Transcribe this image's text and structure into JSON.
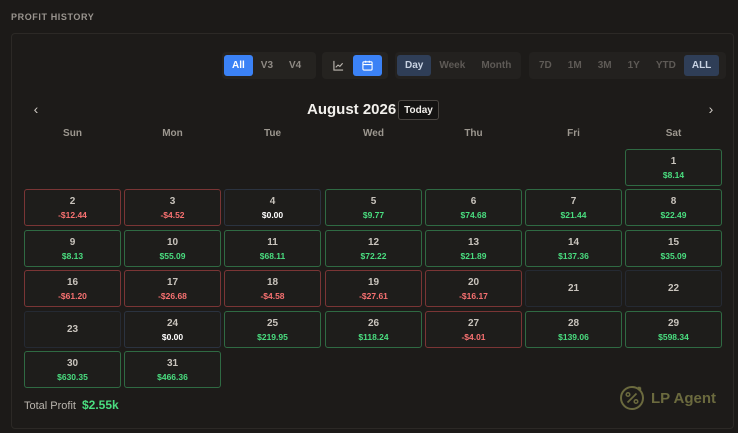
{
  "section_title": "PROFIT HISTORY",
  "version_filter": {
    "options": [
      "All",
      "V3",
      "V4"
    ],
    "selected": "All"
  },
  "view_toggle": {
    "icons": [
      "chart-line-icon",
      "calendar-icon"
    ],
    "selected": "calendar-icon"
  },
  "granularity_filter": {
    "options": [
      "Day",
      "Week",
      "Month"
    ],
    "selected": "Day"
  },
  "range_filter": {
    "options": [
      "7D",
      "1M",
      "3M",
      "1Y",
      "YTD",
      "ALL"
    ],
    "selected": "ALL"
  },
  "calendar": {
    "month_label": "August 2026",
    "today_label": "Today",
    "weekdays": [
      "Sun",
      "Mon",
      "Tue",
      "Wed",
      "Thu",
      "Fri",
      "Sat"
    ],
    "days": [
      {
        "day": "1",
        "amount": "$8.14",
        "status": "pos"
      },
      {
        "day": "2",
        "amount": "-$12.44",
        "status": "neg"
      },
      {
        "day": "3",
        "amount": "-$4.52",
        "status": "neg"
      },
      {
        "day": "4",
        "amount": "$0.00",
        "status": "zero"
      },
      {
        "day": "5",
        "amount": "$9.77",
        "status": "pos"
      },
      {
        "day": "6",
        "amount": "$74.68",
        "status": "pos"
      },
      {
        "day": "7",
        "amount": "$21.44",
        "status": "pos"
      },
      {
        "day": "8",
        "amount": "$22.49",
        "status": "pos"
      },
      {
        "day": "9",
        "amount": "$8.13",
        "status": "pos"
      },
      {
        "day": "10",
        "amount": "$55.09",
        "status": "pos"
      },
      {
        "day": "11",
        "amount": "$68.11",
        "status": "pos"
      },
      {
        "day": "12",
        "amount": "$72.22",
        "status": "pos"
      },
      {
        "day": "13",
        "amount": "$21.89",
        "status": "pos"
      },
      {
        "day": "14",
        "amount": "$137.36",
        "status": "pos"
      },
      {
        "day": "15",
        "amount": "$35.09",
        "status": "pos"
      },
      {
        "day": "16",
        "amount": "-$61.20",
        "status": "neg"
      },
      {
        "day": "17",
        "amount": "-$26.68",
        "status": "neg"
      },
      {
        "day": "18",
        "amount": "-$4.58",
        "status": "neg"
      },
      {
        "day": "19",
        "amount": "-$27.61",
        "status": "neg"
      },
      {
        "day": "20",
        "amount": "-$16.17",
        "status": "neg"
      },
      {
        "day": "21",
        "amount": "",
        "status": "empty"
      },
      {
        "day": "22",
        "amount": "",
        "status": "empty"
      },
      {
        "day": "23",
        "amount": "",
        "status": "empty"
      },
      {
        "day": "24",
        "amount": "$0.00",
        "status": "zero"
      },
      {
        "day": "25",
        "amount": "$219.95",
        "status": "pos"
      },
      {
        "day": "26",
        "amount": "$118.24",
        "status": "pos"
      },
      {
        "day": "27",
        "amount": "-$4.01",
        "status": "neg"
      },
      {
        "day": "28",
        "amount": "$139.06",
        "status": "pos"
      },
      {
        "day": "29",
        "amount": "$598.34",
        "status": "pos"
      },
      {
        "day": "30",
        "amount": "$630.35",
        "status": "pos"
      },
      {
        "day": "31",
        "amount": "$466.36",
        "status": "pos"
      }
    ]
  },
  "total": {
    "label": "Total Profit",
    "value": "$2.55k"
  },
  "brand": {
    "name": "LP Agent",
    "icon": "percent-circle-icon"
  },
  "colors": {
    "accent": "#3b82f6",
    "positive": "#4ade80",
    "negative": "#f87171",
    "brand": "#6b6a3e"
  }
}
